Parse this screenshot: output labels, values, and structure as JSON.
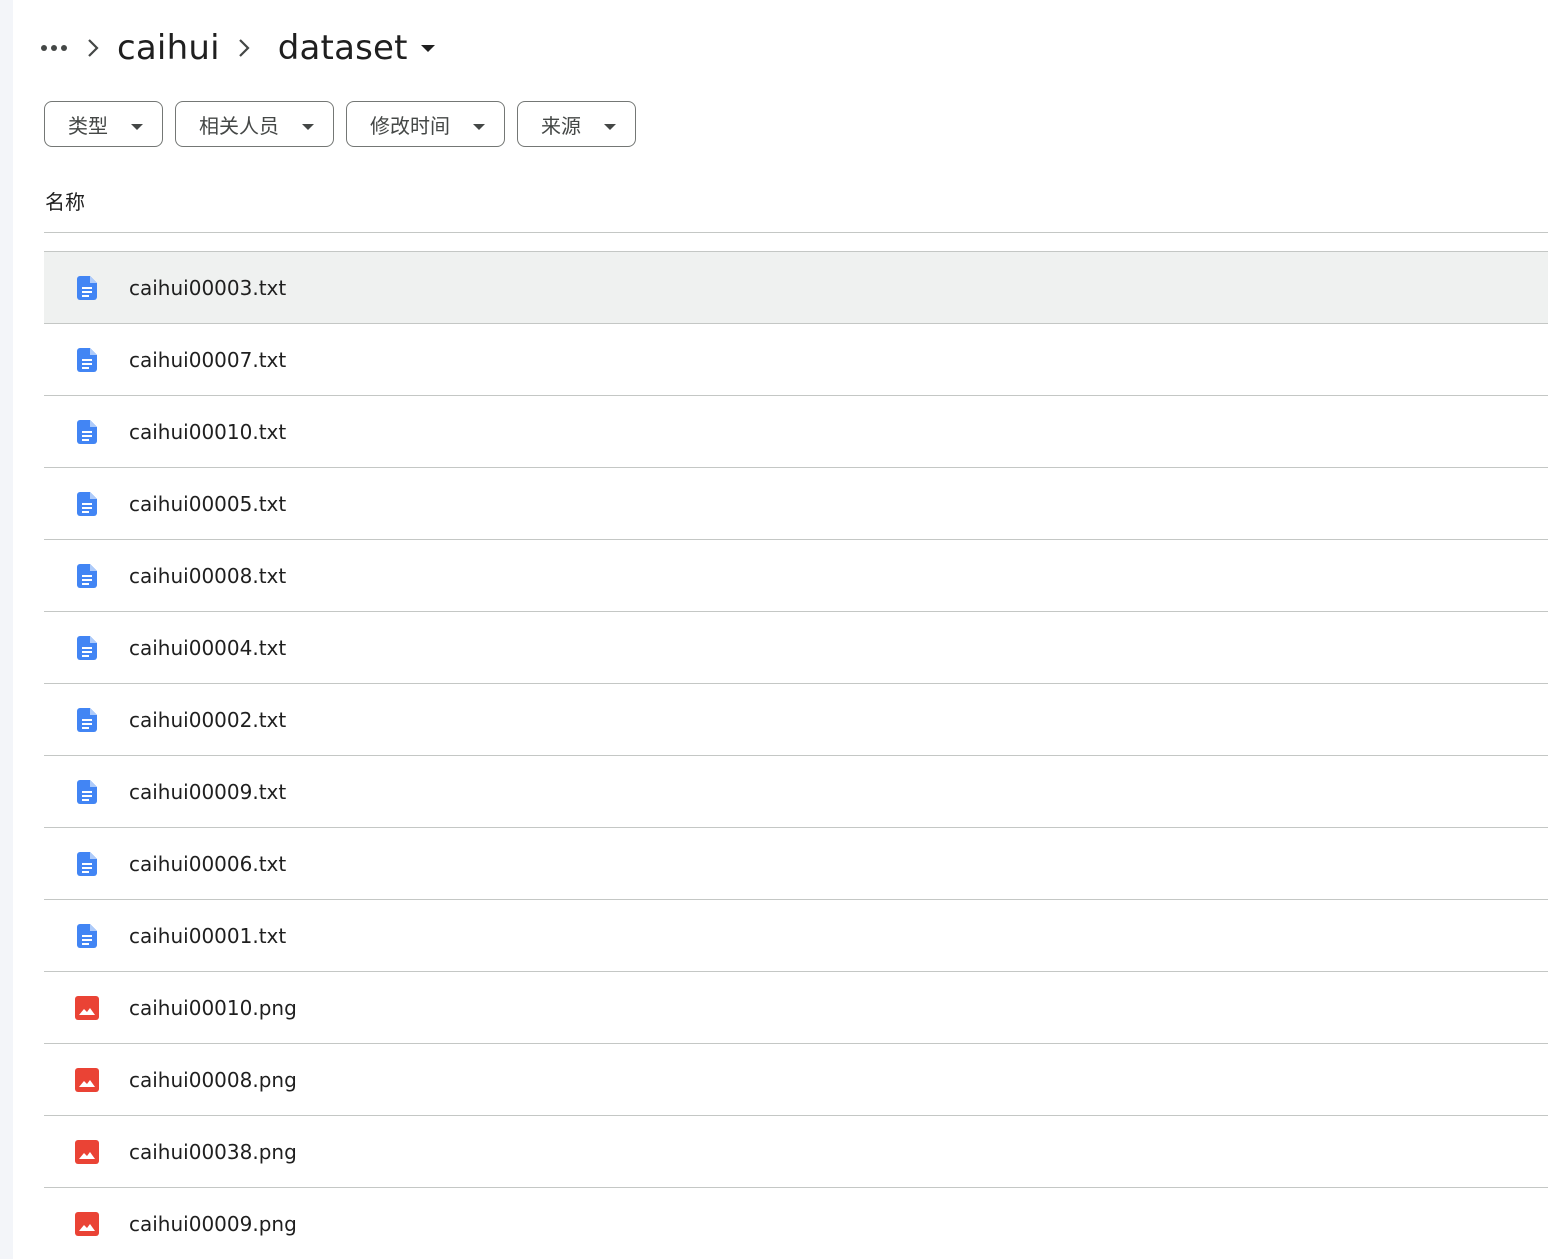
{
  "breadcrumb": {
    "more_icon": "more-horiz-icon",
    "separator_icon": "chevron-right-icon",
    "parent": "caihui",
    "current": "dataset",
    "current_icon": "arrow-drop-down-icon"
  },
  "filters": [
    {
      "label": "类型",
      "icon": "arrow-drop-down-icon"
    },
    {
      "label": "相关人员",
      "icon": "arrow-drop-down-icon"
    },
    {
      "label": "修改时间",
      "icon": "arrow-drop-down-icon"
    },
    {
      "label": "来源",
      "icon": "arrow-drop-down-icon"
    }
  ],
  "list": {
    "column_header": "名称",
    "selected_index": 0,
    "files": [
      {
        "name": "caihui00003.txt",
        "type": "doc"
      },
      {
        "name": "caihui00007.txt",
        "type": "doc"
      },
      {
        "name": "caihui00010.txt",
        "type": "doc"
      },
      {
        "name": "caihui00005.txt",
        "type": "doc"
      },
      {
        "name": "caihui00008.txt",
        "type": "doc"
      },
      {
        "name": "caihui00004.txt",
        "type": "doc"
      },
      {
        "name": "caihui00002.txt",
        "type": "doc"
      },
      {
        "name": "caihui00009.txt",
        "type": "doc"
      },
      {
        "name": "caihui00006.txt",
        "type": "doc"
      },
      {
        "name": "caihui00001.txt",
        "type": "doc"
      },
      {
        "name": "caihui00010.png",
        "type": "image"
      },
      {
        "name": "caihui00008.png",
        "type": "image"
      },
      {
        "name": "caihui00038.png",
        "type": "image"
      },
      {
        "name": "caihui00009.png",
        "type": "image"
      }
    ]
  },
  "colors": {
    "doc_icon": "#4285f4",
    "image_icon": "#ea4335",
    "selected_row": "#eff1f0",
    "divider": "#c4c7c5",
    "chip_border": "#747775"
  }
}
